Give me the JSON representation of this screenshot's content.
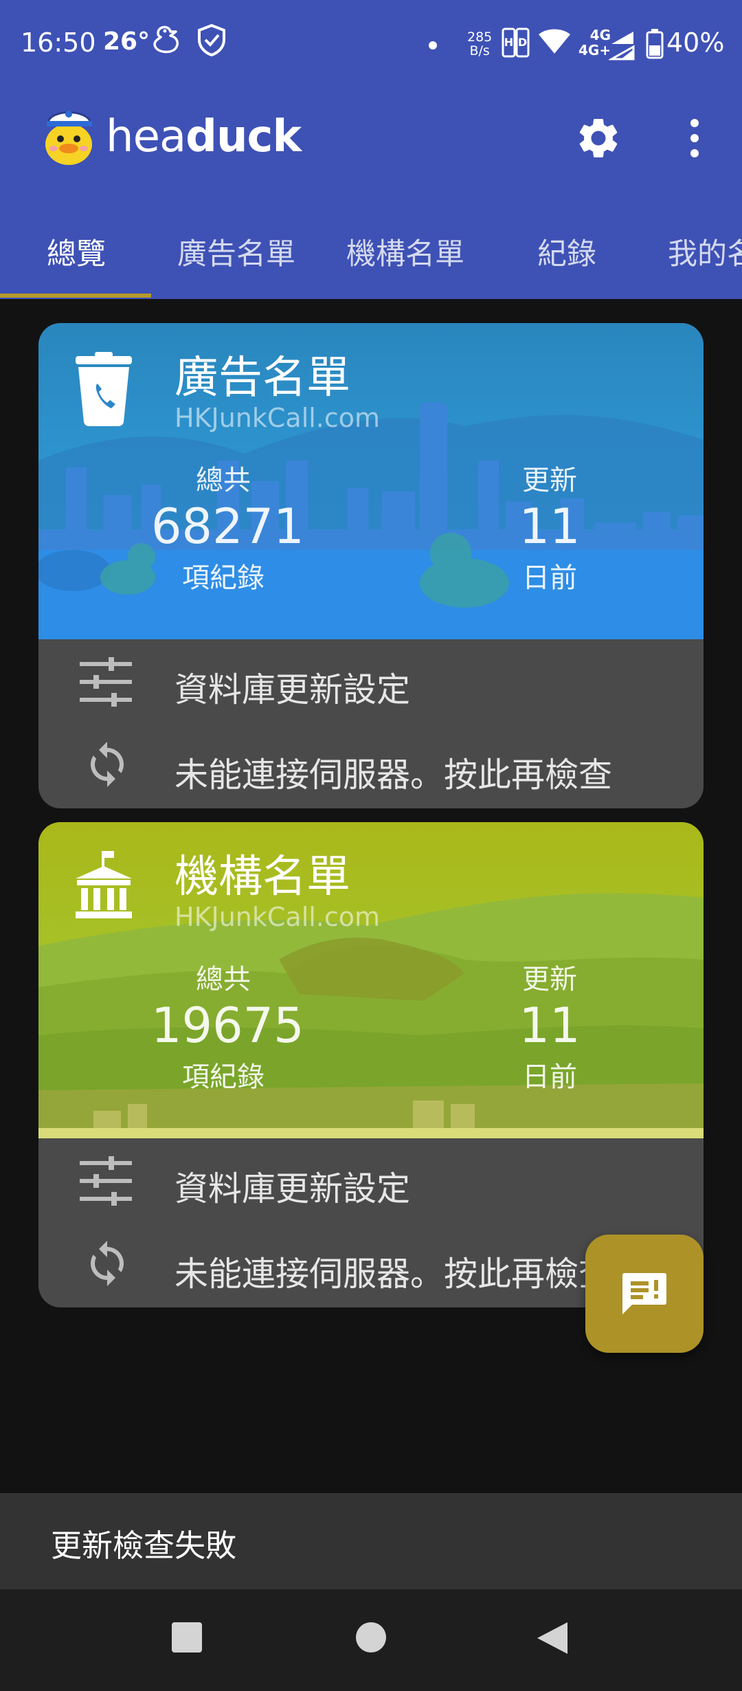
{
  "status_bar": {
    "time": "16:50",
    "temperature": "26°",
    "net_speed_value": "285",
    "net_speed_unit": "B/s",
    "signal_label_1": "4G",
    "signal_label_2": "4G+",
    "battery": "40%",
    "icons": [
      "duck-notification-icon",
      "shield-icon",
      "dot-icon",
      "hd-icon",
      "wifi-icon",
      "cell-signal-icon",
      "battery-icon"
    ]
  },
  "app_bar": {
    "title_light": "hea",
    "title_bold": "duck",
    "actions": [
      "settings-gear-icon",
      "more-vert-icon"
    ],
    "color": "#3e51b5"
  },
  "tabs": [
    {
      "label": "總覽",
      "active": true
    },
    {
      "label": "廣告名單",
      "active": false
    },
    {
      "label": "機構名單",
      "active": false
    },
    {
      "label": "紀錄",
      "active": false
    },
    {
      "label": "我的名單",
      "active": false
    }
  ],
  "cards": [
    {
      "title": "廣告名單",
      "source": "HKJunkCall.com",
      "total_label": "總共",
      "total_value": "68271",
      "total_unit": "項紀錄",
      "updated_label": "更新",
      "updated_value": "11",
      "updated_unit": "日前",
      "icon": "trash-phone-icon",
      "settings_label": "資料庫更新設定",
      "status_label": "未能連接伺服器。按此再檢查",
      "theme_color": "#2f8ed8"
    },
    {
      "title": "機構名單",
      "source": "HKJunkCall.com",
      "total_label": "總共",
      "total_value": "19675",
      "total_unit": "項紀錄",
      "updated_label": "更新",
      "updated_value": "11",
      "updated_unit": "日前",
      "icon": "institution-building-icon",
      "settings_label": "資料庫更新設定",
      "status_label": "未能連接伺服器。按此再檢查",
      "theme_color": "#9ac22c"
    }
  ],
  "fab": {
    "icon": "feedback-icon",
    "color": "#ad9228"
  },
  "snackbar": {
    "message": "更新檢查失敗"
  },
  "nav_bar": {
    "buttons": [
      "recents-square-icon",
      "home-circle-icon",
      "back-triangle-icon"
    ]
  }
}
